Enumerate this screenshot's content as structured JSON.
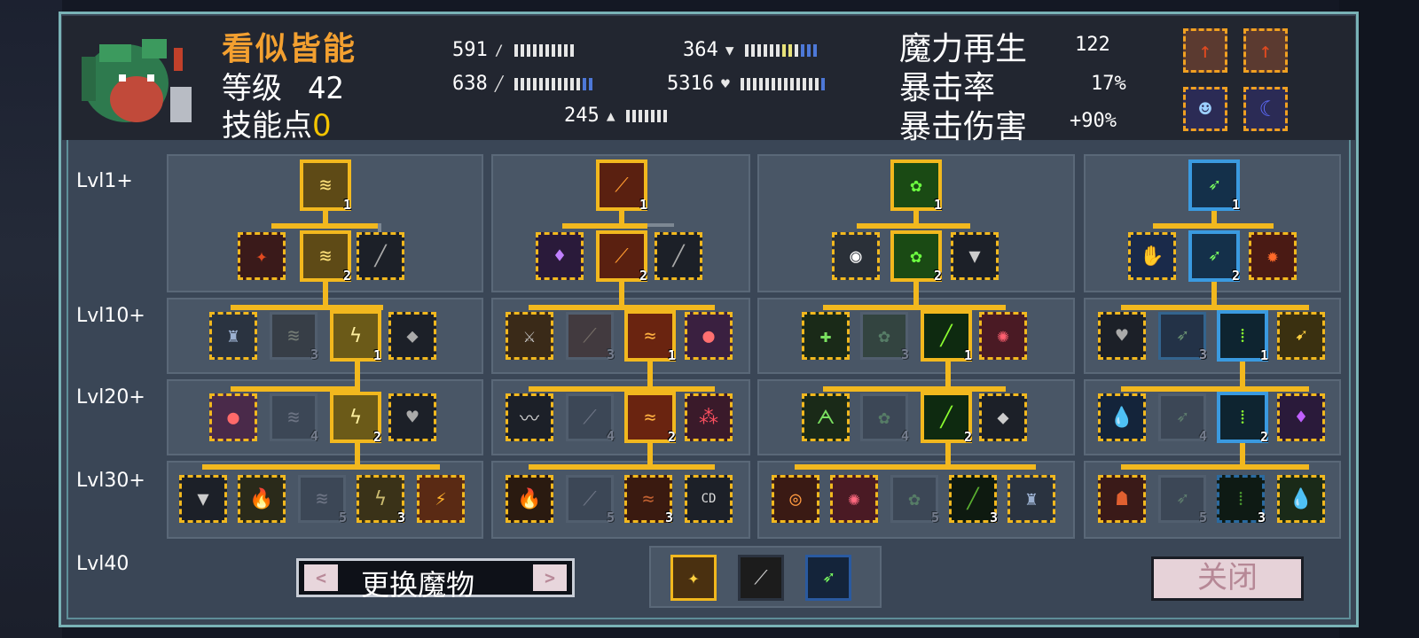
{
  "monster": {
    "name": "看似皆能",
    "level_label": "等级",
    "level": "42",
    "skill_points_label": "技能点",
    "skill_points": "0"
  },
  "stats": [
    {
      "value": "591",
      "icon": "sword-icon"
    },
    {
      "value": "364",
      "icon": "shield-icon"
    },
    {
      "value": "638",
      "icon": "wand-icon"
    },
    {
      "value": "5316",
      "icon": "heart-icon"
    },
    {
      "value": "245",
      "icon": "speed-icon"
    }
  ],
  "regen": {
    "label": "魔力再生",
    "value": "122"
  },
  "crit_rate": {
    "label": "暴击率",
    "value": "17%"
  },
  "crit_damage": {
    "label": "暴击伤害",
    "value": "+90%"
  },
  "levels": [
    "Lvl1+",
    "Lvl10+",
    "Lvl20+",
    "Lvl30+",
    "Lvl40"
  ],
  "footer": {
    "swap_label": "更换魔物",
    "prev": "<",
    "next": ">",
    "close_label": "关闭"
  },
  "trees": [
    {
      "root": "1",
      "t1": [
        "",
        "2",
        ""
      ],
      "t10": [
        "",
        "3",
        "1",
        ""
      ],
      "t20": [
        "",
        "4",
        "2",
        ""
      ],
      "t30": [
        "",
        "",
        "5",
        "3",
        ""
      ]
    },
    {
      "root": "1",
      "t1": [
        "",
        "2",
        ""
      ],
      "t10": [
        "",
        "3",
        "1",
        ""
      ],
      "t20": [
        "",
        "4",
        "2",
        ""
      ],
      "t30": [
        "",
        "5",
        "3",
        ""
      ]
    },
    {
      "root": "1",
      "t1": [
        "",
        "2",
        ""
      ],
      "t10": [
        "",
        "3",
        "1",
        ""
      ],
      "t20": [
        "",
        "4",
        "2",
        ""
      ],
      "t30": [
        "",
        "",
        "5",
        "3",
        ""
      ]
    },
    {
      "root": "1",
      "t1": [
        "",
        "2",
        ""
      ],
      "t10": [
        "",
        "3",
        "1",
        ""
      ],
      "t20": [
        "",
        "4",
        "2",
        ""
      ],
      "t30": [
        "",
        "5",
        "3",
        ""
      ]
    }
  ],
  "colors": {
    "accent": "#f2b81e",
    "name": "#f3a030",
    "skill_points": "#f3c400"
  }
}
